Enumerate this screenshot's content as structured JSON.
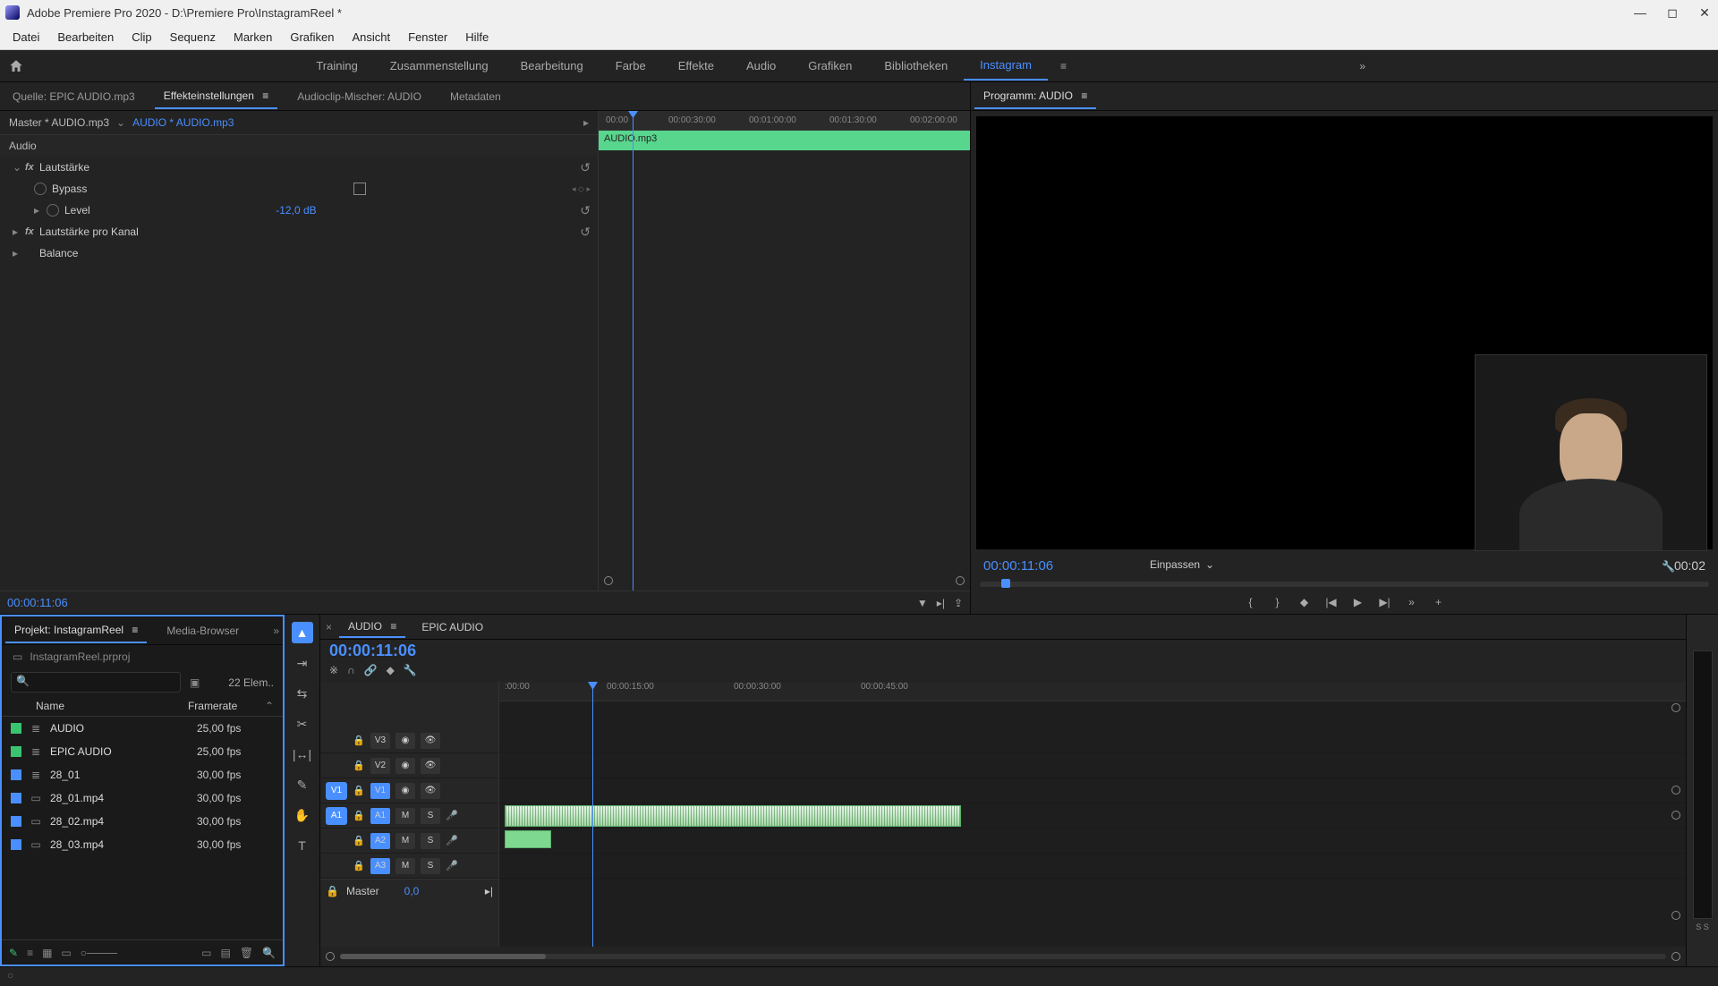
{
  "titlebar": {
    "text": "Adobe Premiere Pro 2020 - D:\\Premiere Pro\\InstagramReel *"
  },
  "menubar": [
    "Datei",
    "Bearbeiten",
    "Clip",
    "Sequenz",
    "Marken",
    "Grafiken",
    "Ansicht",
    "Fenster",
    "Hilfe"
  ],
  "workspaces": {
    "items": [
      "Training",
      "Zusammenstellung",
      "Bearbeitung",
      "Farbe",
      "Effekte",
      "Audio",
      "Grafiken",
      "Bibliotheken",
      "Instagram"
    ],
    "active": "Instagram"
  },
  "fx": {
    "tabs": {
      "source": "Quelle: EPIC AUDIO.mp3",
      "effect_controls": "Effekteinstellungen",
      "audioclip_mixer": "Audioclip-Mischer: AUDIO",
      "metadata": "Metadaten"
    },
    "breadcrumb": {
      "master": "Master * AUDIO.mp3",
      "clip": "AUDIO * AUDIO.mp3"
    },
    "group_label": "Audio",
    "rows": {
      "volume": "Lautstärke",
      "bypass": "Bypass",
      "level": "Level",
      "level_value": "-12,0 dB",
      "channel_volume": "Lautstärke pro Kanal",
      "balance": "Balance"
    },
    "ruler": [
      "00:00",
      "00:00:30:00",
      "00:01:00:00",
      "00:01:30:00",
      "00:02:00:00"
    ],
    "clip_name": "AUDIO.mp3",
    "current_time": "00:00:11:06"
  },
  "program": {
    "title": "Programm: AUDIO",
    "time_left": "00:00:11:06",
    "fit_label": "Einpassen",
    "time_right": "00:02"
  },
  "project": {
    "tab_project": "Projekt: InstagramReel",
    "tab_media": "Media-Browser",
    "filename": "InstagramReel.prproj",
    "search_placeholder": "",
    "count_label": "22 Elem..",
    "col_name": "Name",
    "col_fps": "Framerate",
    "items": [
      {
        "swatch": "green",
        "name": "AUDIO",
        "fps": "25,00 fps",
        "type": "seq"
      },
      {
        "swatch": "green",
        "name": "EPIC AUDIO",
        "fps": "25,00 fps",
        "type": "seq"
      },
      {
        "swatch": "blue",
        "name": "28_01",
        "fps": "30,00 fps",
        "type": "seq"
      },
      {
        "swatch": "blue",
        "name": "28_01.mp4",
        "fps": "30,00 fps",
        "type": "clip"
      },
      {
        "swatch": "blue",
        "name": "28_02.mp4",
        "fps": "30,00 fps",
        "type": "clip"
      },
      {
        "swatch": "blue",
        "name": "28_03.mp4",
        "fps": "30,00 fps",
        "type": "clip"
      }
    ]
  },
  "timeline": {
    "tab_active": "AUDIO",
    "tab_inactive": "EPIC AUDIO",
    "current_time": "00:00:11:06",
    "ruler": [
      ":00:00",
      "00:00:15:00",
      "00:00:30:00",
      "00:00:45:00"
    ],
    "tracks": {
      "v3": "V3",
      "v2": "V2",
      "v1": "V1",
      "v1p": "V1",
      "a1": "A1",
      "a1p": "A1",
      "a2": "A2",
      "a3": "A3",
      "master": "Master",
      "master_val": "0,0",
      "m": "M",
      "s": "S"
    },
    "meters_label": "S S"
  },
  "colors": {
    "accent": "#4a8fff",
    "audio_clip": "#7fd88f"
  }
}
